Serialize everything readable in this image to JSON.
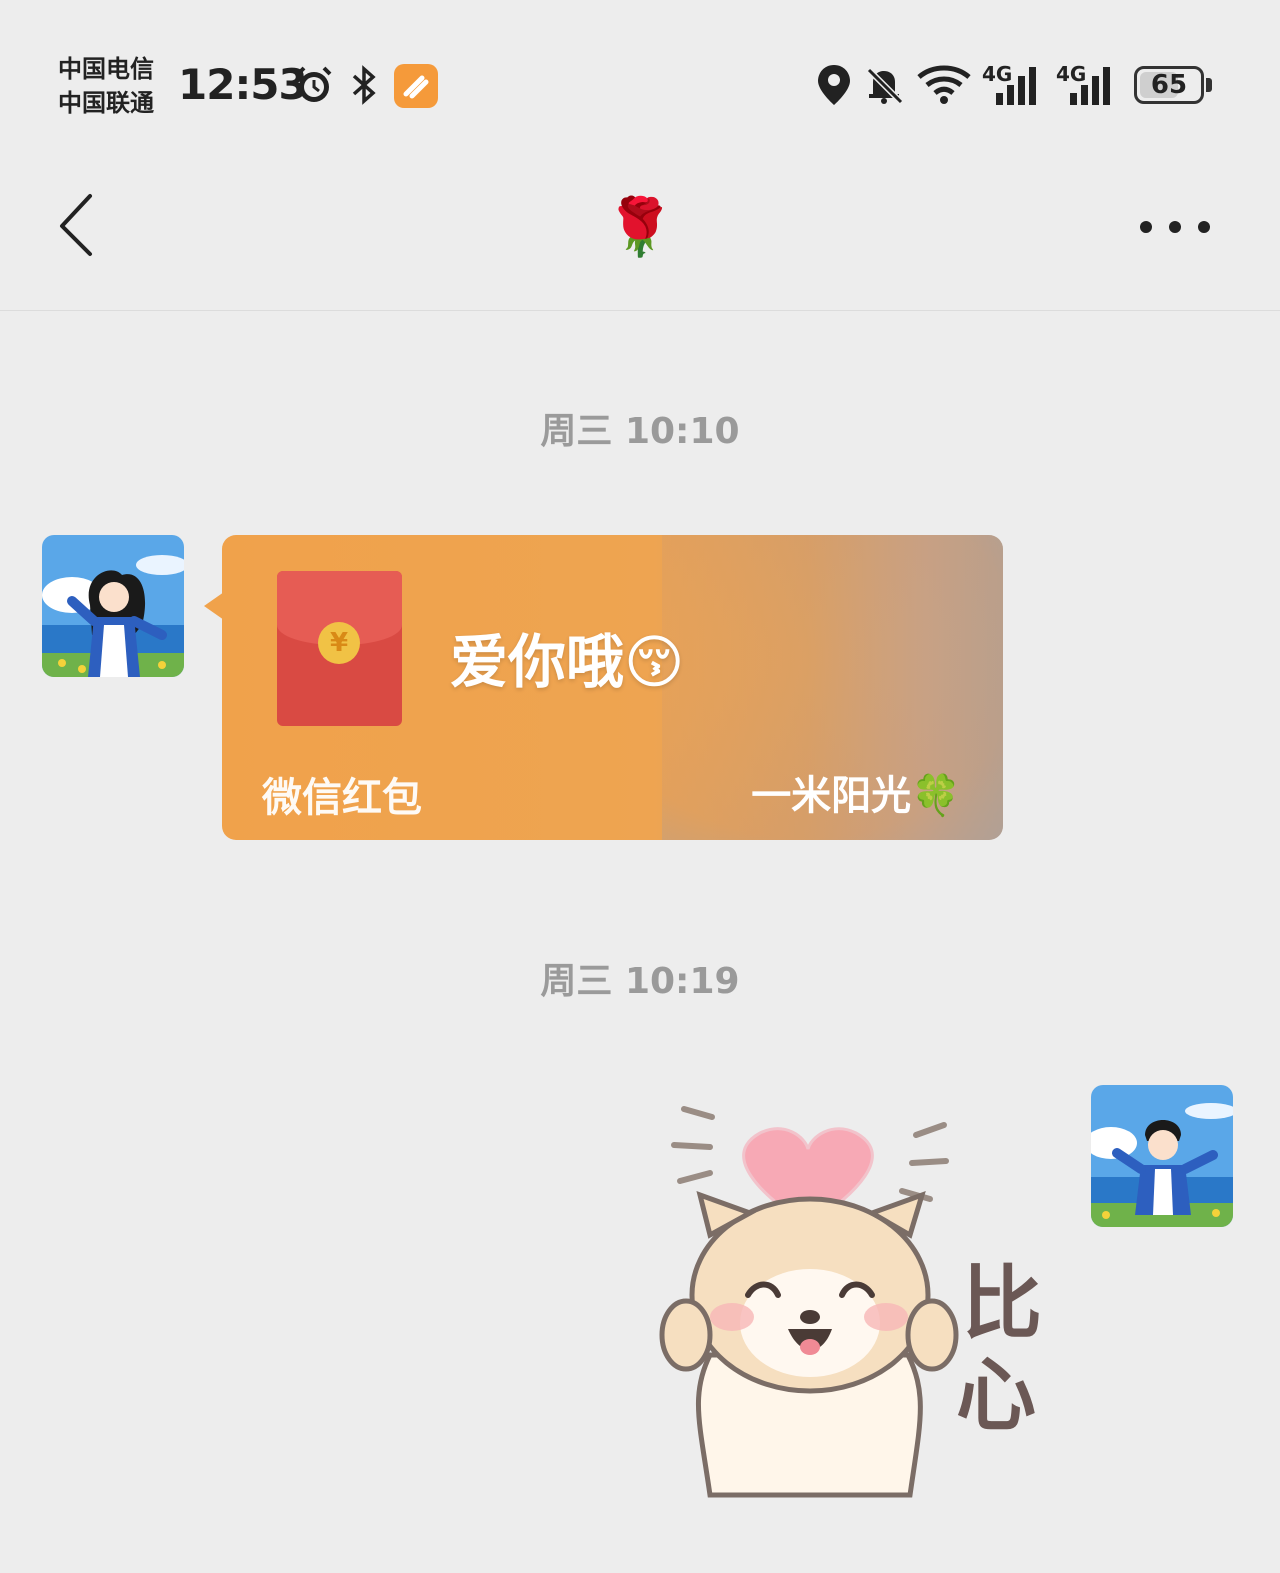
{
  "status_bar": {
    "carrier_1": "中国电信",
    "carrier_2": "中国联通",
    "time": "12:53",
    "network_1": "4G",
    "network_2": "4G",
    "battery": "65",
    "battery_level_percent": 65,
    "icons": [
      "alarm-icon",
      "bluetooth-icon",
      "app-badge-icon",
      "location-icon",
      "bell-muted-icon",
      "wifi-icon",
      "signal-icon",
      "signal-icon",
      "battery-icon"
    ]
  },
  "header": {
    "title": "🌹",
    "back_icon": "chevron-left-icon",
    "more_icon": "more-dots-icon"
  },
  "messages": [
    {
      "timestamp": "周三 10:10",
      "sender": "contact",
      "type": "red-packet",
      "greeting": "爱你哦😚",
      "brand": "微信红包",
      "theme_name": "一米阳光🍀",
      "coin_symbol": "¥"
    },
    {
      "timestamp": "周三 10:19",
      "sender": "self",
      "type": "sticker",
      "sticker_text_1": "比",
      "sticker_text_2": "心"
    }
  ],
  "colors": {
    "background": "#ededed",
    "packet_orange": "#f0a24b",
    "envelope_red": "#d94a43",
    "coin_gold": "#f1c245"
  }
}
